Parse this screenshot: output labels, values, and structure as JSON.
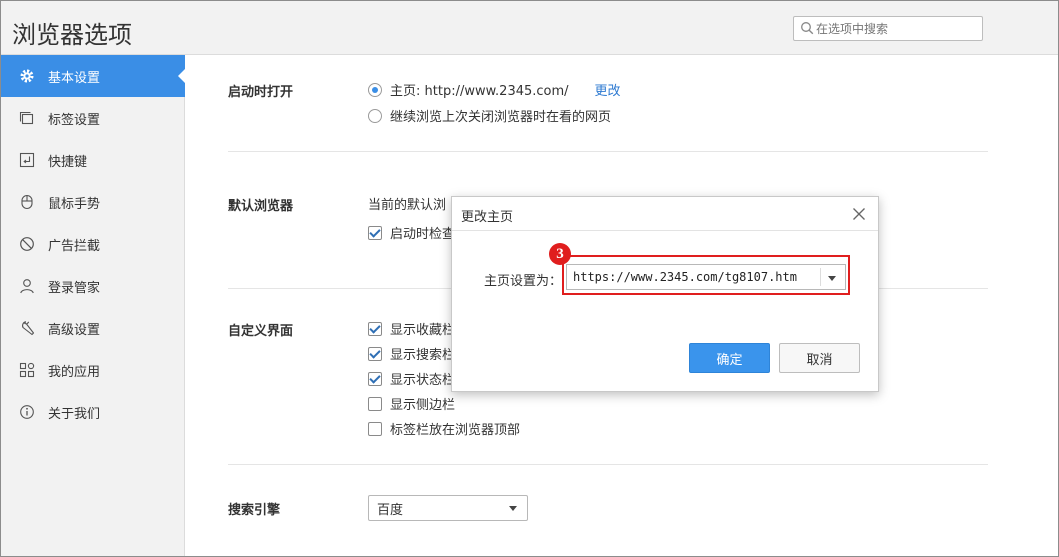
{
  "window": {
    "title": "浏览器选项"
  },
  "search": {
    "placeholder": "在选项中搜索"
  },
  "sidebar": {
    "items": [
      {
        "label": "基本设置",
        "icon": "gear-icon",
        "active": true
      },
      {
        "label": "标签设置",
        "icon": "tabs-icon"
      },
      {
        "label": "快捷键",
        "icon": "shortcut-icon"
      },
      {
        "label": "鼠标手势",
        "icon": "mouse-icon"
      },
      {
        "label": "广告拦截",
        "icon": "block-icon"
      },
      {
        "label": "登录管家",
        "icon": "user-icon"
      },
      {
        "label": "高级设置",
        "icon": "wrench-icon"
      },
      {
        "label": "我的应用",
        "icon": "apps-icon"
      },
      {
        "label": "关于我们",
        "icon": "info-icon"
      }
    ]
  },
  "startup": {
    "title": "启动时打开",
    "opt_home": "主页: http://www.2345.com/",
    "opt_home_checked": true,
    "change_link": "更改",
    "opt_restore": "继续浏览上次关闭浏览器时在看的网页",
    "opt_restore_checked": false
  },
  "default_browser": {
    "title": "默认浏览器",
    "current_text": "当前的默认浏",
    "check_label": "启动时检查",
    "check_checked": true
  },
  "ui_custom": {
    "title": "自定义界面",
    "options": [
      {
        "label": "显示收藏栏",
        "checked": true
      },
      {
        "label": "显示搜索栏",
        "checked": true
      },
      {
        "label": "显示状态栏",
        "checked": true
      },
      {
        "label": "显示侧边栏",
        "checked": false
      },
      {
        "label": "标签栏放在浏览器顶部",
        "checked": false
      }
    ]
  },
  "search_engine": {
    "title": "搜索引擎",
    "selected": "百度"
  },
  "dialog": {
    "title": "更改主页",
    "label": "主页设置为：",
    "url_value": "https://www.2345.com/tg8107.htm",
    "ok_label": "确定",
    "cancel_label": "取消",
    "step_badge": "3",
    "highlight_color": "#e01e1e"
  },
  "colors": {
    "accent": "#3a8ee6",
    "link": "#2e7ad1",
    "highlight": "#e01e1e"
  }
}
